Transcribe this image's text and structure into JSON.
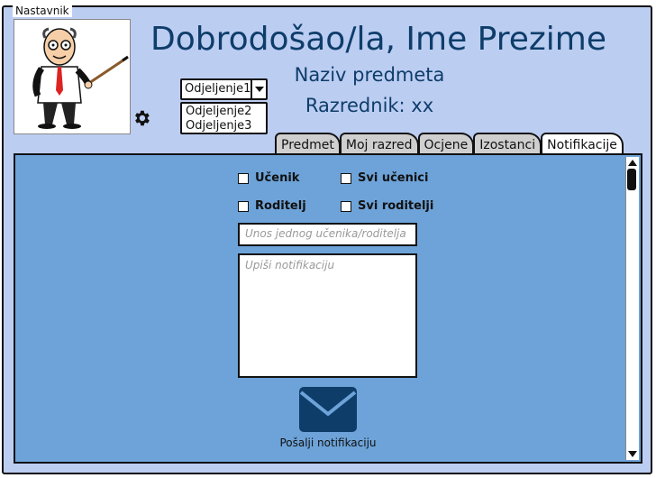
{
  "window": {
    "title": "Nastavnik"
  },
  "header": {
    "welcome": "Dobrodošao/la, Ime Prezime",
    "subject": "Naziv predmeta",
    "homeroom": "Razrednik: xx"
  },
  "class_select": {
    "value": "Odjeljenje1",
    "options": [
      "Odjeljenje2",
      "Odjeljenje3"
    ]
  },
  "tabs": [
    {
      "label": "Predmet"
    },
    {
      "label": "Moj razred"
    },
    {
      "label": "Ocjene"
    },
    {
      "label": "Izostanci"
    },
    {
      "label": "Notifikacije",
      "active": true
    }
  ],
  "recipients": {
    "student": "Učenik",
    "all_students": "Svi učenici",
    "parent": "Roditelj",
    "all_parents": "Svi roditelji"
  },
  "single_input": {
    "placeholder": "Unos jednog učenika/roditelja"
  },
  "message": {
    "placeholder": "Upiši notifikaciju"
  },
  "send": {
    "label": "Pošalji notifikaciju"
  },
  "icons": {
    "settings": "gear-icon",
    "send": "envelope-icon"
  },
  "colors": {
    "panel": "#6da3d8",
    "frame": "#bccdf2",
    "accent": "#0e3d6a"
  }
}
